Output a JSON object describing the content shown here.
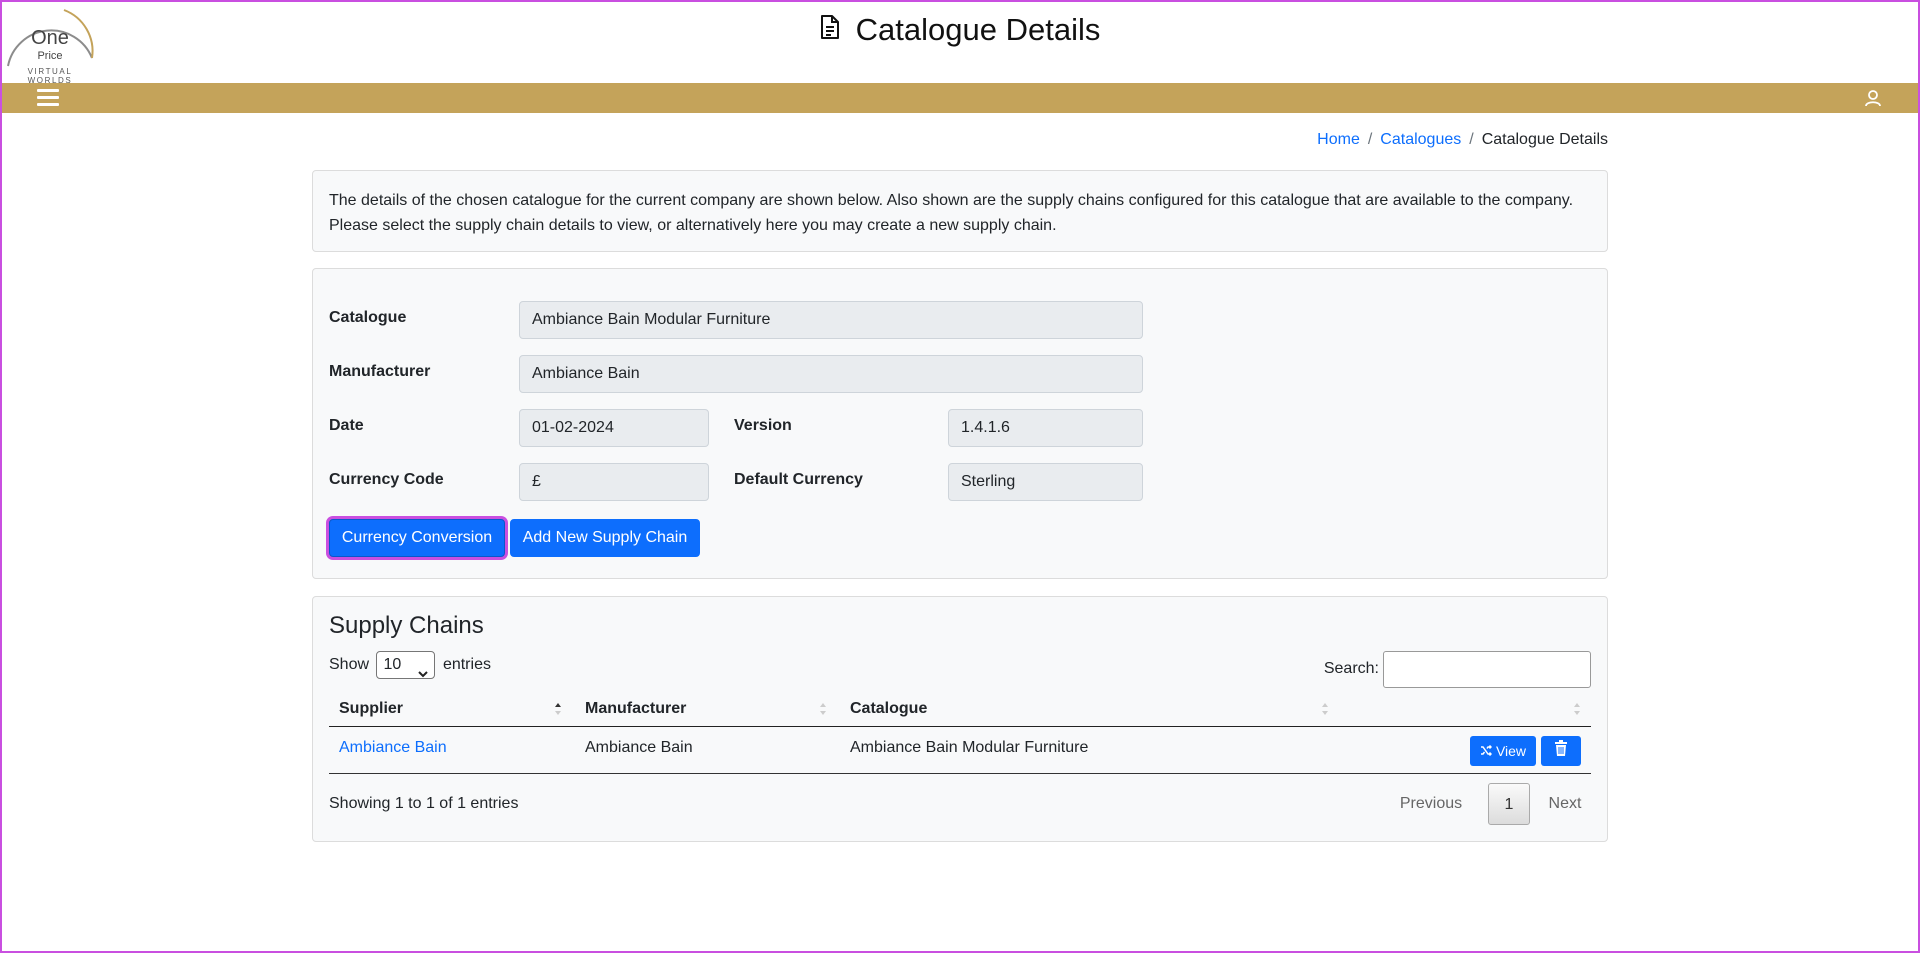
{
  "header": {
    "logo": {
      "line1": "One",
      "line2": "Price",
      "line3": "VIRTUAL WORLDS"
    },
    "title": "Catalogue Details",
    "title_icon": "document-icon",
    "menu_icon": "hamburger-menu-icon",
    "user_icon": "user-icon"
  },
  "breadcrumb": {
    "home": "Home",
    "catalogues": "Catalogues",
    "current": "Catalogue Details"
  },
  "info": {
    "line1": "The details of the chosen catalogue for the current company are shown below. Also shown are the supply chains configured for this catalogue that are available to the company.",
    "line2": "Please select the supply chain details to view, or alternatively here you may create a new supply chain."
  },
  "form": {
    "catalogue_label": "Catalogue",
    "catalogue_value": "Ambiance Bain Modular Furniture",
    "manufacturer_label": "Manufacturer",
    "manufacturer_value": "Ambiance Bain",
    "date_label": "Date",
    "date_value": "01-02-2024",
    "version_label": "Version",
    "version_value": "1.4.1.6",
    "currency_code_label": "Currency Code",
    "currency_code_value": "£",
    "default_currency_label": "Default Currency",
    "default_currency_value": "Sterling",
    "currency_conversion_button": "Currency Conversion",
    "add_supply_chain_button": "Add New Supply Chain"
  },
  "supply_chains": {
    "title": "Supply Chains",
    "show_label": "Show",
    "entries_label": "entries",
    "page_size": "10",
    "search_label": "Search:",
    "search_value": "",
    "columns": [
      "Supplier",
      "Manufacturer",
      "Catalogue",
      ""
    ],
    "rows": [
      {
        "supplier": "Ambiance Bain",
        "manufacturer": "Ambiance Bain",
        "catalogue": "Ambiance Bain Modular Furniture",
        "view_label": "View"
      }
    ],
    "showing": "Showing 1 to 1 of 1 entries",
    "pagination": {
      "previous": "Previous",
      "current": "1",
      "next": "Next"
    }
  },
  "colors": {
    "navbar": "#c4a35a",
    "primary": "#0d6efd",
    "focus_ring": "#c94fe0"
  }
}
